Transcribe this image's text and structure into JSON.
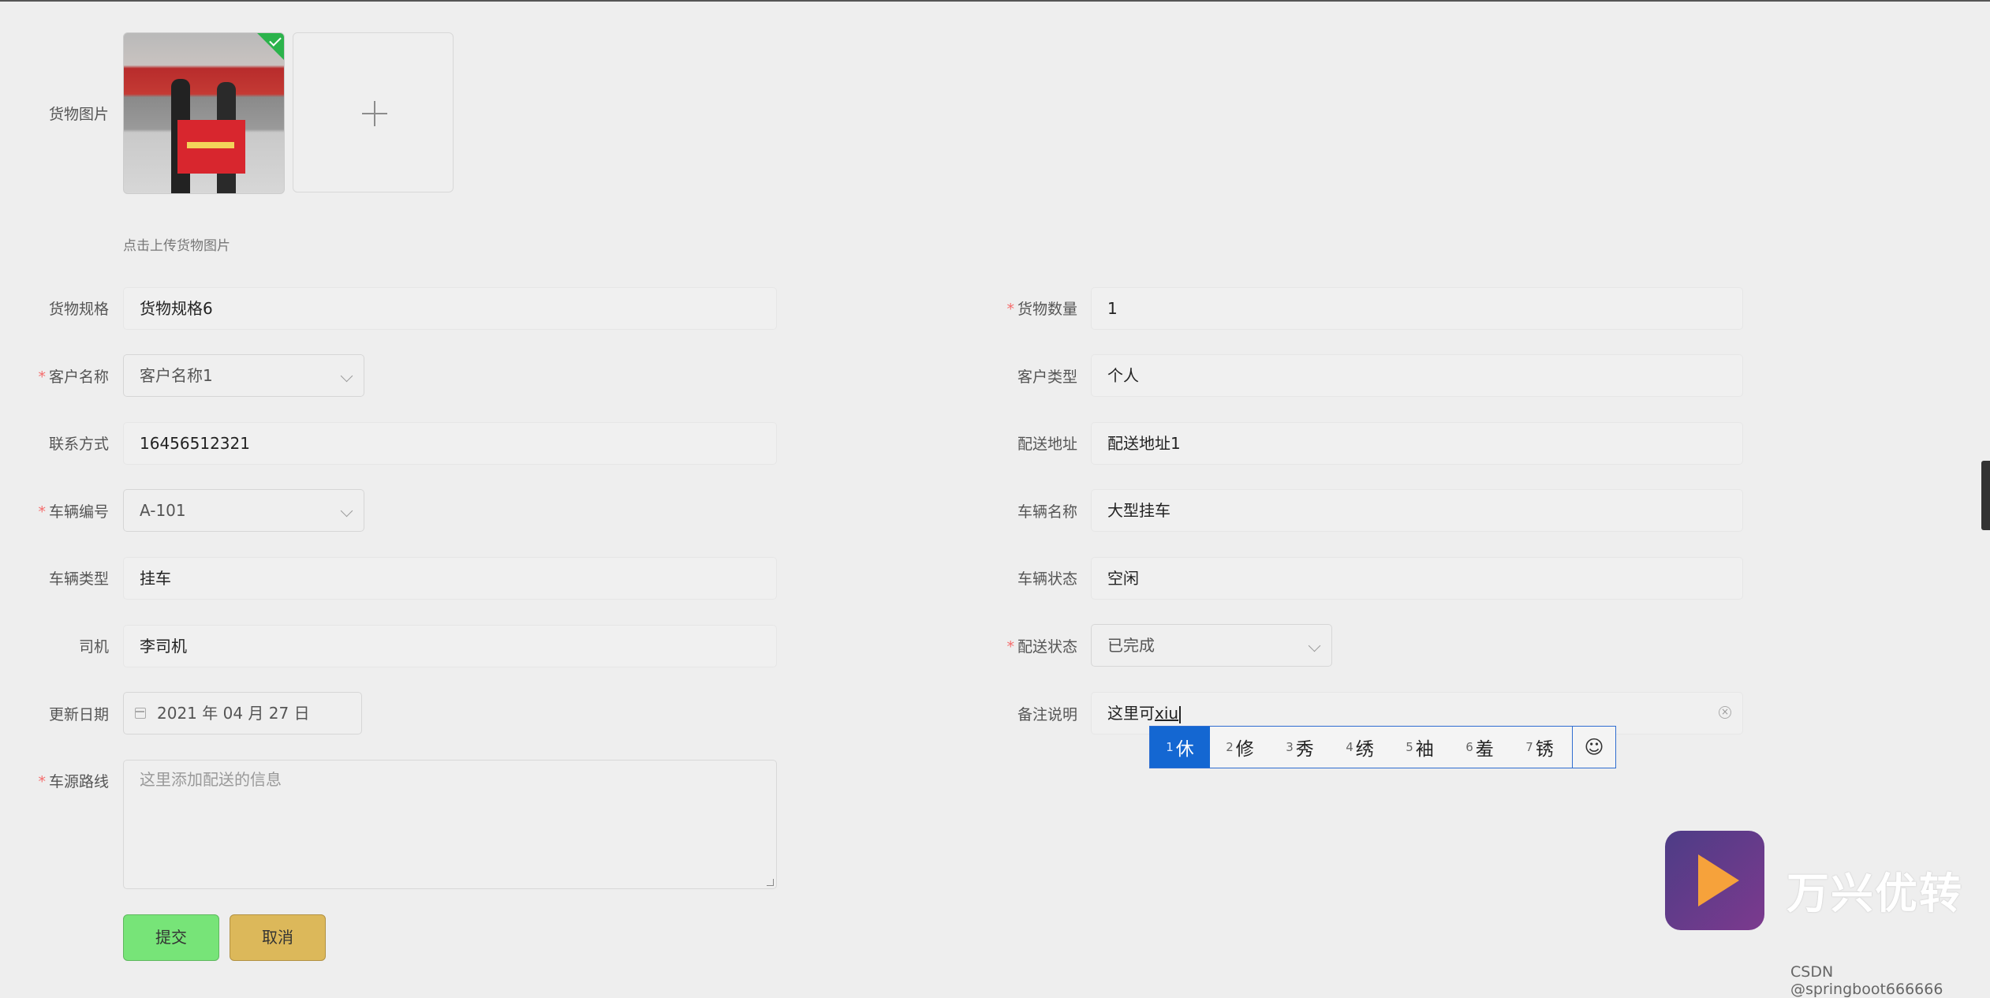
{
  "form": {
    "image_field": {
      "label": "货物图片",
      "hint": "点击上传货物图片"
    },
    "left": [
      {
        "label": "货物规格",
        "required": false,
        "value": "货物规格6",
        "kind": "input"
      },
      {
        "label": "客户名称",
        "required": true,
        "value": "客户名称1",
        "kind": "select"
      },
      {
        "label": "联系方式",
        "required": false,
        "value": "16456512321",
        "kind": "input"
      },
      {
        "label": "车辆编号",
        "required": true,
        "value": "A-101",
        "kind": "select"
      },
      {
        "label": "车辆类型",
        "required": false,
        "value": "挂车",
        "kind": "input"
      },
      {
        "label": "司机",
        "required": false,
        "value": "李司机",
        "kind": "input"
      },
      {
        "label": "更新日期",
        "required": false,
        "value": "2021 年 04 月 27 日",
        "kind": "date"
      }
    ],
    "right": [
      {
        "label": "货物数量",
        "required": true,
        "value": "1",
        "kind": "input"
      },
      {
        "label": "客户类型",
        "required": false,
        "value": "个人",
        "kind": "input"
      },
      {
        "label": "配送地址",
        "required": false,
        "value": "配送地址1",
        "kind": "input"
      },
      {
        "label": "车辆名称",
        "required": false,
        "value": "大型挂车",
        "kind": "input"
      },
      {
        "label": "车辆状态",
        "required": false,
        "value": "空闲",
        "kind": "input"
      },
      {
        "label": "配送状态",
        "required": true,
        "value": "已完成",
        "kind": "select"
      },
      {
        "label": "备注说明",
        "required": false,
        "value": "这里可",
        "composing": "xiu",
        "kind": "input"
      }
    ],
    "route": {
      "label": "车源路线",
      "required": true,
      "placeholder": "这里添加配送的信息"
    },
    "buttons": {
      "submit": "提交",
      "cancel": "取消"
    }
  },
  "ime": {
    "candidates": [
      {
        "n": "1",
        "c": "休"
      },
      {
        "n": "2",
        "c": "修"
      },
      {
        "n": "3",
        "c": "秀"
      },
      {
        "n": "4",
        "c": "绣"
      },
      {
        "n": "5",
        "c": "袖"
      },
      {
        "n": "6",
        "c": "羞"
      },
      {
        "n": "7",
        "c": "锈"
      }
    ],
    "emoji": "☺"
  },
  "watermark": {
    "brand": "万兴优转",
    "csdn": "CSDN @springboot666666"
  },
  "colors": {
    "required": "#f56c6c",
    "submit": "#77e478",
    "cancel": "#dcb85a",
    "ime_selected": "#1467d2"
  }
}
